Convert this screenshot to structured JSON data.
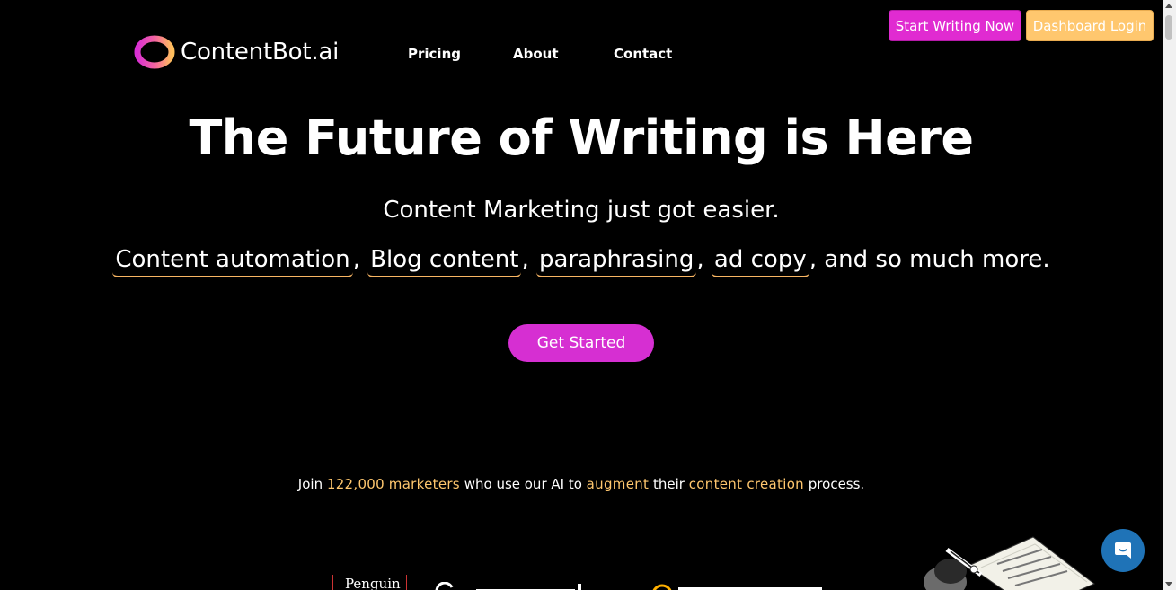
{
  "header": {
    "brand": "ContentBot.ai",
    "nav": {
      "pricing": "Pricing",
      "about": "About",
      "contact": "Contact"
    },
    "start_writing": "Start Writing Now",
    "dashboard_login": "Dashboard Login"
  },
  "hero": {
    "title": "The Future of Writing is Here",
    "subtitle": "Content Marketing just got easier.",
    "features": [
      "Content automation",
      "Blog content",
      "paraphrasing",
      "ad copy"
    ],
    "features_suffix": ", and so much more.",
    "cta": "Get Started"
  },
  "social_proof": {
    "join": "Join",
    "count": "122,000",
    "marketers": "marketers",
    "who_use": "who use our AI to",
    "augment": "augment",
    "their": "their",
    "content_creation": "content creation",
    "process": "process."
  },
  "partners": {
    "penguin": "Penguin"
  },
  "colors": {
    "background": "#000000",
    "magenta": "#e02bd1",
    "gold": "#ffc76e",
    "chat_blue": "#1f73b7"
  },
  "icons": {
    "logo": "contentbot-ring-logo",
    "chat": "chat-bubble-icon"
  }
}
